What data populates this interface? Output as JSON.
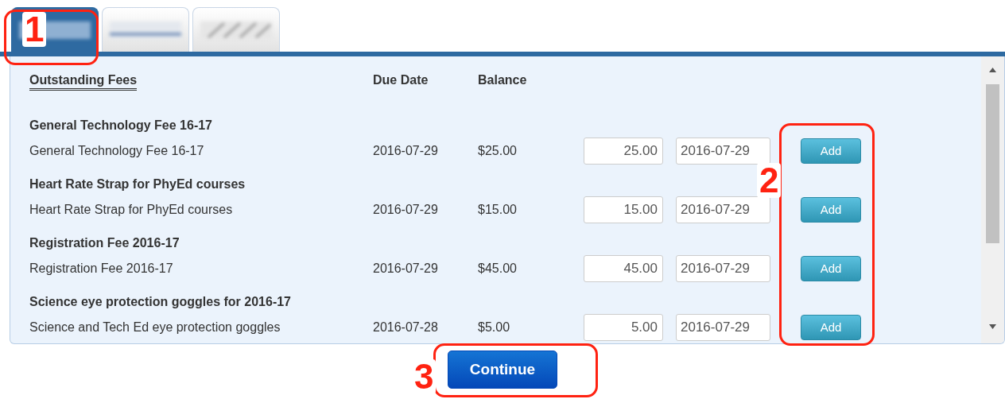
{
  "tabs": [
    {
      "selected": true
    },
    {
      "selected": false
    },
    {
      "selected": false
    }
  ],
  "columns": [
    "Outstanding Fees",
    "Due Date",
    "Balance"
  ],
  "fees": [
    {
      "title": "General Technology Fee 16-17",
      "description": "General Technology Fee 16-17",
      "due_date": "2016-07-29",
      "balance": "$25.00",
      "amount": "25.00",
      "pay_date": "2016-07-29",
      "button": "Add"
    },
    {
      "title": "Heart Rate Strap for PhyEd courses",
      "description": "Heart Rate Strap for PhyEd courses",
      "due_date": "2016-07-29",
      "balance": "$15.00",
      "amount": "15.00",
      "pay_date": "2016-07-29",
      "button": "Add"
    },
    {
      "title": "Registration Fee 2016-17",
      "description": "Registration Fee 2016-17",
      "due_date": "2016-07-29",
      "balance": "$45.00",
      "amount": "45.00",
      "pay_date": "2016-07-29",
      "button": "Add"
    },
    {
      "title": "Science eye protection goggles for 2016-17",
      "description": "Science and Tech Ed eye protection goggles",
      "due_date": "2016-07-28",
      "balance": "$5.00",
      "amount": "5.00",
      "pay_date": "2016-07-29",
      "button": "Add"
    }
  ],
  "continue_button": "Continue",
  "callouts": [
    "1",
    "2",
    "3"
  ]
}
